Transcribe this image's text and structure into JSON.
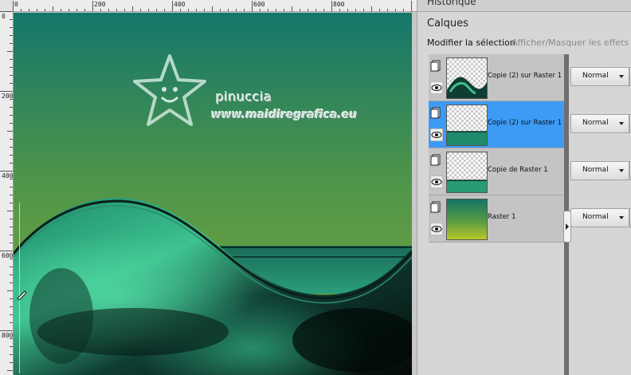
{
  "ruler": {
    "top_labels": [
      "0",
      "200",
      "400",
      "600",
      "800"
    ],
    "left_labels": [
      "0",
      "200",
      "400",
      "600",
      "800"
    ]
  },
  "watermark": {
    "name": "pinuccia",
    "url": "www.maidiregrafica.eu"
  },
  "panel": {
    "history_title": "Historique",
    "layers_title": "Calques",
    "toolbar": {
      "modify_selection": "Modifier la sélection",
      "toggle_effects": "Afficher/Masquer les effets de c"
    },
    "layers": [
      {
        "name": "Copie (2) sur Raster 1",
        "blend": "Normal",
        "selected": false,
        "thumb": "wave-top"
      },
      {
        "name": "Copie (2) sur Raster 1",
        "blend": "Normal",
        "selected": true,
        "thumb": "strip-bottom"
      },
      {
        "name": "Copie de Raster 1",
        "blend": "Normal",
        "selected": false,
        "thumb": "strip-bottom"
      },
      {
        "name": "Raster 1",
        "blend": "Normal",
        "selected": false,
        "thumb": "gradient"
      }
    ]
  },
  "colors": {
    "selection_blue": "#3d9bf5",
    "sky_top": "#16786a",
    "sky_bottom": "#7aa83a",
    "wave_teal": "#2aa582"
  }
}
